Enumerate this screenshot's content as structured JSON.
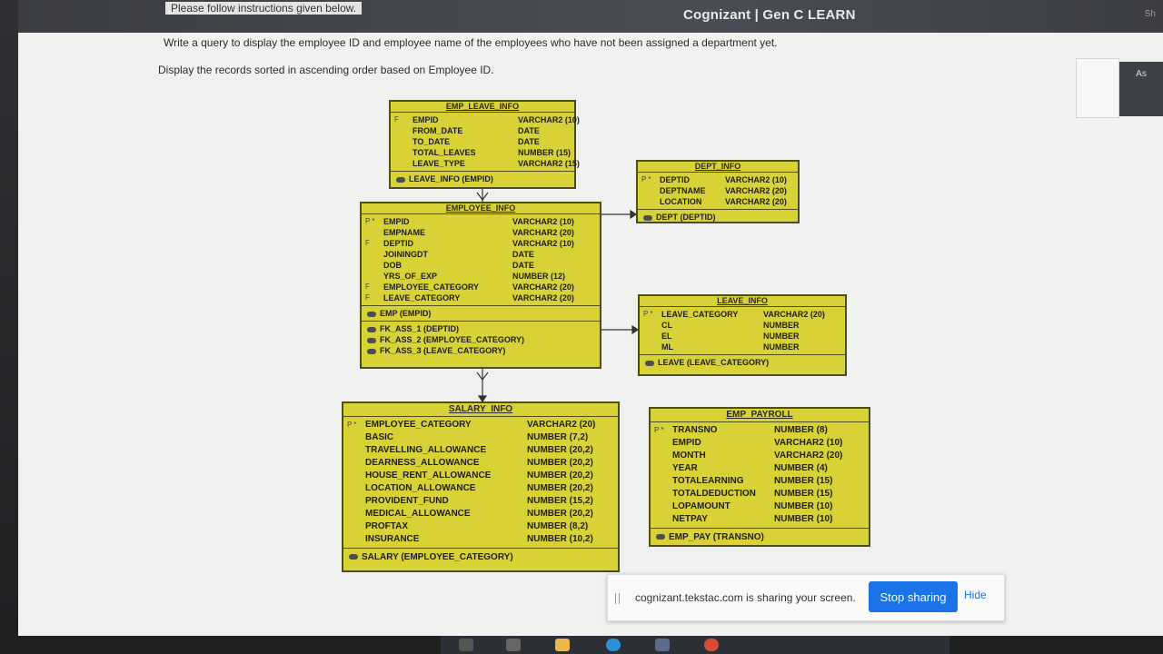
{
  "app": {
    "brand": "Cognizant | Gen C LEARN",
    "corner_label": "Sh"
  },
  "instructions": {
    "top": "Please follow instructions given below.",
    "line1": "Write a query to display the employee ID and employee name of the employees who have not been assigned a department yet.",
    "line2": "Display the records sorted in ascending order based on Employee ID."
  },
  "side_button": {
    "label": "As"
  },
  "tables": {
    "emp_leave_info": {
      "title": "EMP_LEAVE_INFO",
      "columns": [
        {
          "key": "F",
          "name": "EMPID",
          "type": "VARCHAR2 (10)"
        },
        {
          "key": "",
          "name": "FROM_DATE",
          "type": "DATE"
        },
        {
          "key": "",
          "name": "TO_DATE",
          "type": "DATE"
        },
        {
          "key": "",
          "name": "TOTAL_LEAVES",
          "type": "NUMBER (15)"
        },
        {
          "key": "",
          "name": "LEAVE_TYPE",
          "type": "VARCHAR2 (15)"
        }
      ],
      "indexes": [
        "LEAVE_INFO (EMPID)"
      ]
    },
    "dept_info": {
      "title": "DEPT_INFO",
      "columns": [
        {
          "key": "P *",
          "name": "DEPTID",
          "type": "VARCHAR2 (10)"
        },
        {
          "key": "",
          "name": "DEPTNAME",
          "type": "VARCHAR2 (20)"
        },
        {
          "key": "",
          "name": "LOCATION",
          "type": "VARCHAR2 (20)"
        }
      ],
      "indexes": [
        "DEPT (DEPTID)"
      ]
    },
    "employee_info": {
      "title": "EMPLOYEE_INFO",
      "columns": [
        {
          "key": "P *",
          "name": "EMPID",
          "type": "VARCHAR2 (10)"
        },
        {
          "key": "",
          "name": "EMPNAME",
          "type": "VARCHAR2 (20)"
        },
        {
          "key": "F",
          "name": "DEPTID",
          "type": "VARCHAR2 (10)"
        },
        {
          "key": "",
          "name": "JOININGDT",
          "type": "DATE"
        },
        {
          "key": "",
          "name": "DOB",
          "type": "DATE"
        },
        {
          "key": "",
          "name": "YRS_OF_EXP",
          "type": "NUMBER (12)"
        },
        {
          "key": "F",
          "name": "EMPLOYEE_CATEGORY",
          "type": "VARCHAR2 (20)"
        },
        {
          "key": "F",
          "name": "LEAVE_CATEGORY",
          "type": "VARCHAR2 (20)"
        }
      ],
      "indexes": [
        "EMP (EMPID)"
      ],
      "foreign_keys": [
        "FK_ASS_1 (DEPTID)",
        "FK_ASS_2 (EMPLOYEE_CATEGORY)",
        "FK_ASS_3 (LEAVE_CATEGORY)"
      ]
    },
    "leave_info": {
      "title": "LEAVE_INFO",
      "columns": [
        {
          "key": "P *",
          "name": "LEAVE_CATEGORY",
          "type": "VARCHAR2 (20)"
        },
        {
          "key": "",
          "name": "CL",
          "type": "NUMBER"
        },
        {
          "key": "",
          "name": "EL",
          "type": "NUMBER"
        },
        {
          "key": "",
          "name": "ML",
          "type": "NUMBER"
        }
      ],
      "indexes": [
        "LEAVE (LEAVE_CATEGORY)"
      ]
    },
    "salary_info": {
      "title": "SALARY_INFO",
      "columns": [
        {
          "key": "P *",
          "name": "EMPLOYEE_CATEGORY",
          "type": "VARCHAR2 (20)"
        },
        {
          "key": "",
          "name": "BASIC",
          "type": "NUMBER (7,2)"
        },
        {
          "key": "",
          "name": "TRAVELLING_ALLOWANCE",
          "type": "NUMBER (20,2)"
        },
        {
          "key": "",
          "name": "DEARNESS_ALLOWANCE",
          "type": "NUMBER (20,2)"
        },
        {
          "key": "",
          "name": "HOUSE_RENT_ALLOWANCE",
          "type": "NUMBER (20,2)"
        },
        {
          "key": "",
          "name": "LOCATION_ALLOWANCE",
          "type": "NUMBER (20,2)"
        },
        {
          "key": "",
          "name": "PROVIDENT_FUND",
          "type": "NUMBER (15,2)"
        },
        {
          "key": "",
          "name": "MEDICAL_ALLOWANCE",
          "type": "NUMBER (20,2)"
        },
        {
          "key": "",
          "name": "PROFTAX",
          "type": "NUMBER (8,2)"
        },
        {
          "key": "",
          "name": "INSURANCE",
          "type": "NUMBER (10,2)"
        }
      ],
      "indexes": [
        "SALARY (EMPLOYEE_CATEGORY)"
      ]
    },
    "emp_payroll": {
      "title": "EMP_PAYROLL",
      "columns": [
        {
          "key": "P *",
          "name": "TRANSNO",
          "type": "NUMBER (8)"
        },
        {
          "key": "",
          "name": "EMPID",
          "type": "VARCHAR2 (10)"
        },
        {
          "key": "",
          "name": "MONTH",
          "type": "VARCHAR2 (20)"
        },
        {
          "key": "",
          "name": "YEAR",
          "type": "NUMBER (4)"
        },
        {
          "key": "",
          "name": "TOTALEARNING",
          "type": "NUMBER (15)"
        },
        {
          "key": "",
          "name": "TOTALDEDUCTION",
          "type": "NUMBER (15)"
        },
        {
          "key": "",
          "name": "LOPAMOUNT",
          "type": "NUMBER (10)"
        },
        {
          "key": "",
          "name": "NETPAY",
          "type": "NUMBER (10)"
        }
      ],
      "indexes": [
        "EMP_PAY (TRANSNO)"
      ]
    }
  },
  "share_bar": {
    "message": "cognizant.tekstac.com is sharing your screen.",
    "stop_label": "Stop sharing",
    "hide_label": "Hide"
  },
  "colors": {
    "table_fill": "#d9d237",
    "table_border": "#4f4d1a",
    "stop_button": "#1a73e8"
  }
}
